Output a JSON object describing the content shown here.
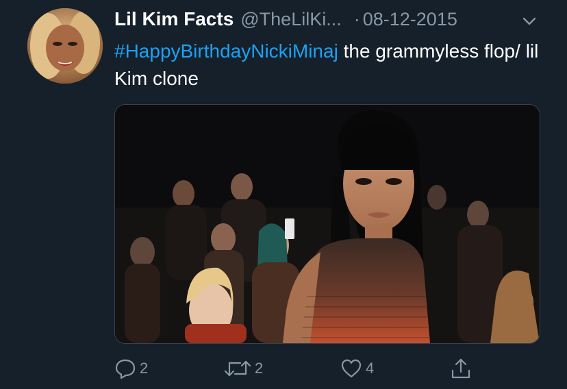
{
  "tweet": {
    "display_name": "Lil Kim Facts",
    "handle": "@TheLilKi...",
    "separator": "·",
    "date": "08-12-2015",
    "hashtag": "#HappyBirthdayNickiMinaj",
    "text_after_hashtag": " the grammyless flop/ lil Kim clone"
  },
  "actions": {
    "replies": "2",
    "retweets": "2",
    "likes": "4"
  },
  "colors": {
    "background": "#15202b",
    "accent": "#1da1f2",
    "muted": "#8899a6"
  },
  "icons": [
    "chevron-down-icon",
    "reply-icon",
    "retweet-icon",
    "like-icon",
    "share-icon"
  ]
}
